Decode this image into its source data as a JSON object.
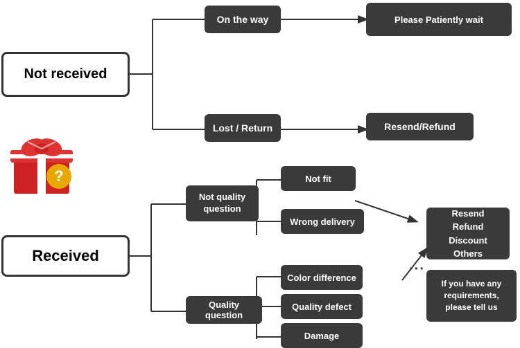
{
  "nodes": {
    "not_received": {
      "label": "Not received"
    },
    "on_the_way": {
      "label": "On the way"
    },
    "please_wait": {
      "label": "Please Patiently wait"
    },
    "lost_return": {
      "label": "Lost / Return"
    },
    "resend_refund": {
      "label": "Resend/Refund"
    },
    "received": {
      "label": "Received"
    },
    "not_quality": {
      "label": "Not quality\nquestion"
    },
    "quality_q": {
      "label": "Quality question"
    },
    "not_fit": {
      "label": "Not fit"
    },
    "wrong_delivery": {
      "label": "Wrong delivery"
    },
    "color_diff": {
      "label": "Color difference"
    },
    "quality_defect": {
      "label": "Quality defect"
    },
    "damage": {
      "label": "Damage"
    },
    "resend_options": {
      "label": "Resend\nRefund\nDiscount\nOthers"
    },
    "contact_us": {
      "label": "If you have any\nrequirements,\nplease tell us"
    }
  }
}
